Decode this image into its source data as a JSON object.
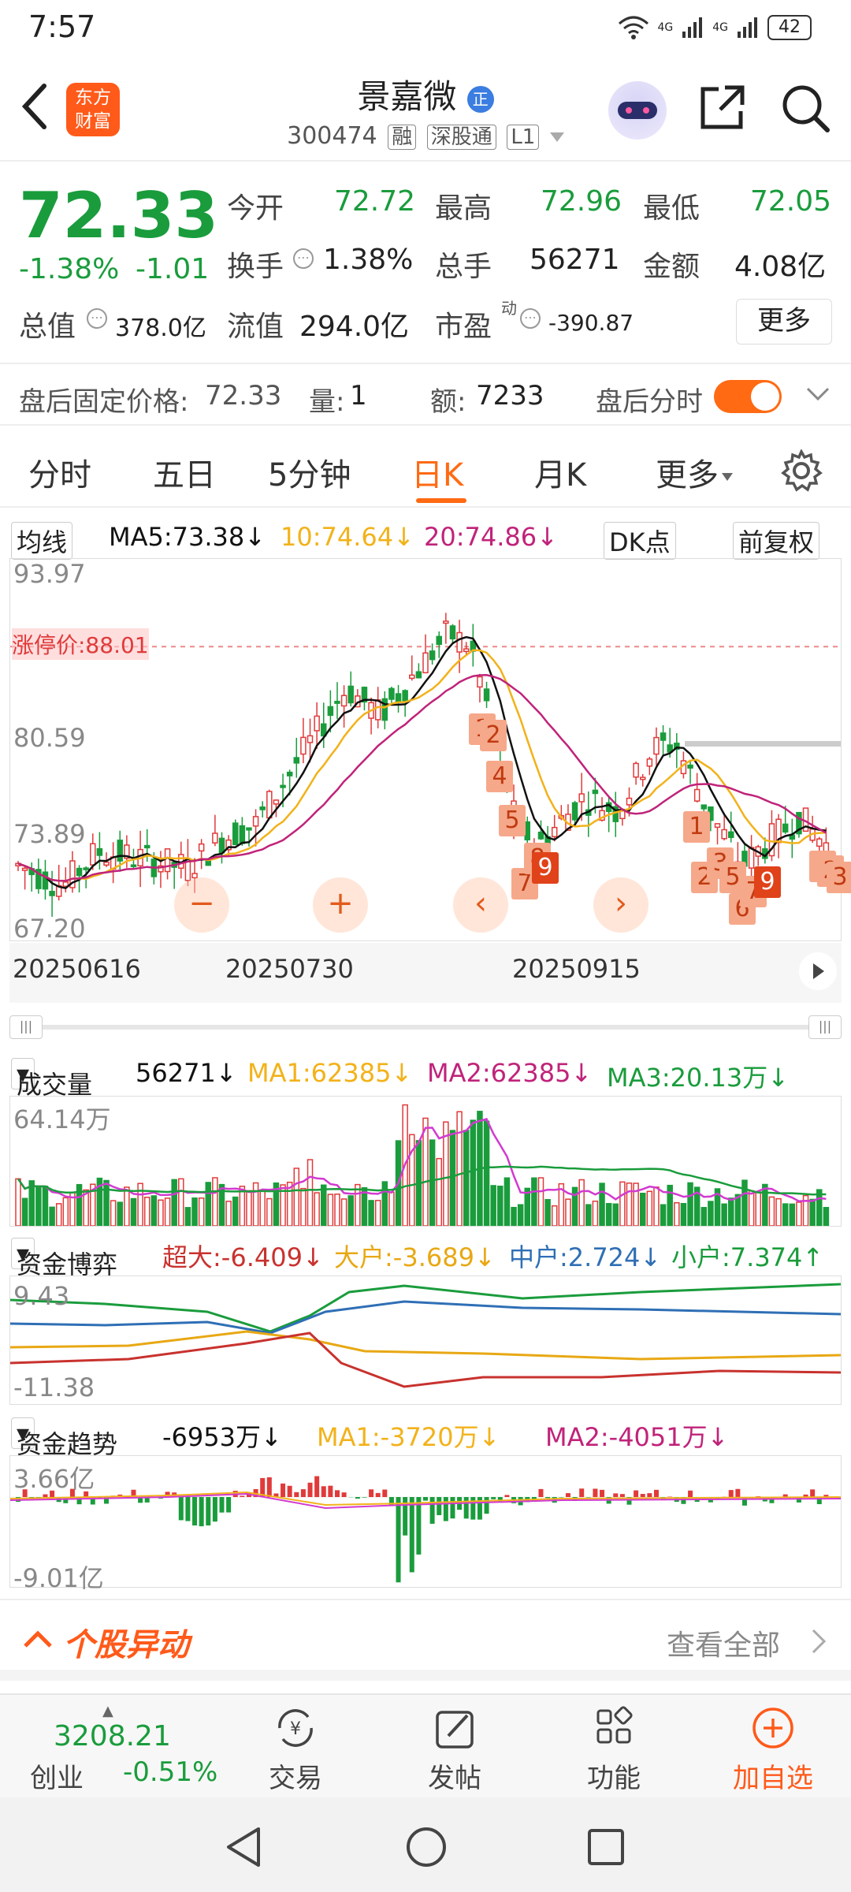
{
  "status_bar": {
    "time": "7:57",
    "battery": "42",
    "signal1": "4G",
    "signal2": "4G"
  },
  "header": {
    "stock_name": "景嘉微",
    "name_badge": "正",
    "code": "300474",
    "tags": [
      "融",
      "深股通",
      "L1"
    ],
    "logo_line1": "东方",
    "logo_line2": "财富"
  },
  "quote": {
    "price": "72.33",
    "change_pct": "-1.38%",
    "change": "-1.01",
    "open_label": "今开",
    "open": "72.72",
    "high_label": "最高",
    "high": "72.96",
    "low_label": "最低",
    "low": "72.05",
    "turnover_label": "换手",
    "turnover": "1.38%",
    "volume_label": "总手",
    "volume": "56271",
    "amount_label": "金额",
    "amount": "4.08亿",
    "mktcap_label": "总值",
    "mktcap": "378.0亿",
    "float_label": "流值",
    "float": "294.0亿",
    "pe_label": "市盈",
    "pe_sup": "动",
    "pe": "-390.87",
    "more_label": "更多"
  },
  "after_hours": {
    "fixed_label": "盘后固定价格:",
    "fixed_price": "72.33",
    "qty_label": "量:",
    "qty": "1",
    "amt_label": "额:",
    "amt": "7233",
    "toggle_label": "盘后分时"
  },
  "tabs": [
    "分时",
    "五日",
    "5分钟",
    "日K",
    "月K",
    "更多"
  ],
  "active_tab": "日K",
  "ma_row": {
    "selector": "均线",
    "ma5": "MA5:73.38↓",
    "ma10": "10:74.64↓",
    "ma20": "20:74.86↓",
    "dk": "DK点",
    "adjust": "前复权"
  },
  "kline": {
    "ytop": "93.97",
    "y2": "80.59",
    "y3": "73.89",
    "ybottom": "67.20",
    "ref_line": "88.01",
    "ref_label": "涨停价:88.01",
    "dates": [
      "20250616",
      "20250730",
      "20250915"
    ],
    "markers": [
      "1",
      "2",
      "3",
      "4",
      "5",
      "6",
      "7",
      "8",
      "9"
    ]
  },
  "volume_row": {
    "selector": "成交量",
    "vol": "56271↓",
    "ma1": "MA1:62385↓",
    "ma2": "MA2:62385↓",
    "ma3": "MA3:20.13万↓",
    "ytop": "64.14万"
  },
  "fund_game_row": {
    "selector": "资金博弈",
    "super": "超大:-6.409↓",
    "large": "大户:-3.689↓",
    "mid": "中户:2.724↓",
    "small": "小户:7.374↑",
    "ytop": "9.43",
    "ybottom": "-11.38"
  },
  "fund_trend_row": {
    "selector": "资金趋势",
    "value": "-6953万↓",
    "ma1": "MA1:-3720万↓",
    "ma2": "MA2:-4051万↓",
    "ytop": "3.66亿",
    "ybottom": "-9.01亿"
  },
  "movement": {
    "title": "个股异动",
    "view_all": "查看全部"
  },
  "bottom_nav": {
    "index_value": "3208.21",
    "index_name": "创业",
    "index_change": "-0.51%",
    "trade": "交易",
    "post": "发帖",
    "function": "功能",
    "add": "加自选"
  },
  "colors": {
    "accent": "#ff6a13",
    "down": "#1a9c3c",
    "up": "#e03a3a",
    "ma5": "#111111",
    "ma10": "#f2b21a",
    "ma20": "#c0237a"
  }
}
